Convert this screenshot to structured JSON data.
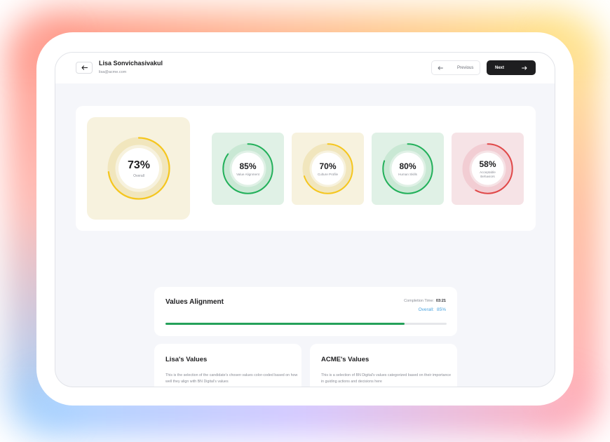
{
  "header": {
    "candidate_name": "Lisa Sonvichasivakul",
    "candidate_email": "lisa@acme.com",
    "previous_label": "Previous",
    "next_label": "Next"
  },
  "scores": {
    "overall": {
      "value": 73,
      "display": "73%",
      "label": "Overall",
      "color": "#f5c61e",
      "bg": "#f7f2de"
    },
    "categories": [
      {
        "value": 85,
        "display": "85%",
        "label": "Value Alignment",
        "color": "#22b05a",
        "bg": "#e0f1e6"
      },
      {
        "value": 70,
        "display": "70%",
        "label": "Culture Profile",
        "color": "#f5c61e",
        "bg": "#f7f2de"
      },
      {
        "value": 80,
        "display": "80%",
        "label": "Human Skills",
        "color": "#22b05a",
        "bg": "#e0f1e6"
      },
      {
        "value": 58,
        "display": "58%",
        "label": "Acceptable Behaviors",
        "color": "#e04848",
        "bg": "#f6e3e6"
      }
    ]
  },
  "values_alignment": {
    "title": "Values Alignment",
    "completion_label": "Completion Time:",
    "completion_time": "03:21",
    "overall_label": "Overall:",
    "overall_value": "85%",
    "progress": 0.85,
    "progress_color": "#25a15a"
  },
  "lisa_values": {
    "title": "Lisa's Values",
    "description": "This is the selection of the candidate's chosen values color-coded based on how well they align with BN Digital's values"
  },
  "acme_values": {
    "title": "ACME's Values",
    "description": "This is a selection of BN Digital's values categorized based on their importance in guiding actions and decisions here"
  }
}
